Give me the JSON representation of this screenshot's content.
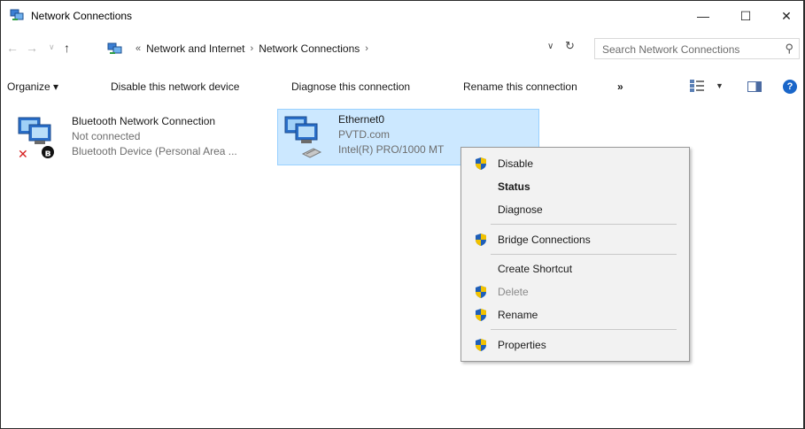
{
  "window": {
    "title": "Network Connections",
    "controls": {
      "minimize": "—",
      "maximize": "☐",
      "close": "✕"
    }
  },
  "address": {
    "prefix": "«",
    "crumbs": [
      "Network and Internet",
      "Network Connections"
    ],
    "separator": "›",
    "search_placeholder": "Search Network Connections"
  },
  "commands": {
    "organize": "Organize ▾",
    "disable": "Disable this network device",
    "diagnose": "Diagnose this connection",
    "rename": "Rename this connection",
    "more": "»",
    "help": "?"
  },
  "connections": [
    {
      "name": "Bluetooth Network Connection",
      "status": "Not connected",
      "device": "Bluetooth Device (Personal Area ..."
    },
    {
      "name": "Ethernet0",
      "status": "PVTD.com",
      "device": "Intel(R) PRO/1000 MT"
    }
  ],
  "context_menu": {
    "items": [
      {
        "label": "Disable",
        "shield": true
      },
      {
        "label": "Status",
        "bold": true
      },
      {
        "label": "Diagnose"
      },
      {
        "label": "Bridge Connections",
        "shield": true
      },
      {
        "label": "Create Shortcut"
      },
      {
        "label": "Delete",
        "shield": true,
        "disabled": true
      },
      {
        "label": "Rename",
        "shield": true
      },
      {
        "label": "Properties",
        "shield": true
      }
    ]
  },
  "colors": {
    "selection_bg": "#cce8ff",
    "selection_border": "#99d1ff",
    "help_blue": "#1a66c9",
    "menu_bg": "#f2f2f2"
  }
}
